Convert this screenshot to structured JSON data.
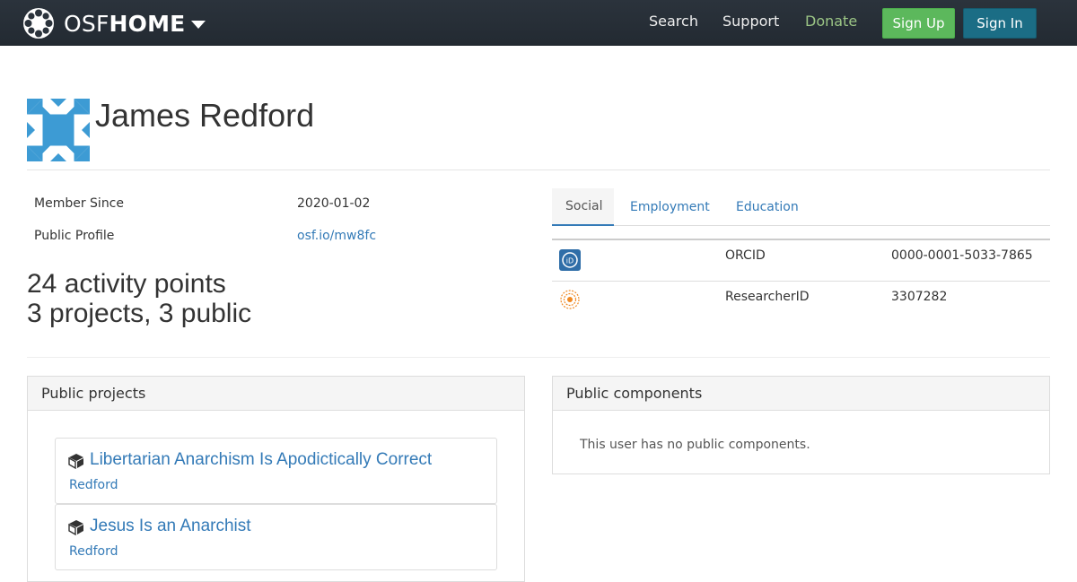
{
  "navbar": {
    "brand_light": "OSF",
    "brand_bold": "HOME",
    "search": "Search",
    "support": "Support",
    "donate": "Donate",
    "sign_up": "Sign Up",
    "sign_in": "Sign In"
  },
  "profile": {
    "name": "James Redford",
    "member_since_label": "Member Since",
    "member_since_value": "2020-01-02",
    "public_profile_label": "Public Profile",
    "public_profile_value": "osf.io/mw8fc",
    "activity_points": "24 activity points",
    "projects_summary": "3 projects, 3 public"
  },
  "tabs": [
    {
      "label": "Social"
    },
    {
      "label": "Employment"
    },
    {
      "label": "Education"
    }
  ],
  "social": [
    {
      "icon": "orcid-icon",
      "name": "ORCID",
      "value": "0000-0001-5033-7865"
    },
    {
      "icon": "researcherid-icon",
      "name": "ResearcherID",
      "value": "3307282"
    }
  ],
  "public_projects": {
    "heading": "Public projects",
    "items": [
      {
        "title": "Libertarian Anarchism Is Apodictically Correct",
        "author": "Redford"
      },
      {
        "title": "Jesus Is an Anarchist",
        "author": "Redford"
      }
    ]
  },
  "public_components": {
    "heading": "Public components",
    "empty_message": "This user has no public components."
  },
  "colors": {
    "navbar": "#2b333c",
    "link": "#337ab7",
    "sign_up": "#5cb85c",
    "sign_in": "#1b6d85",
    "donate": "#9bc585",
    "avatar": "#3d9bd4"
  }
}
